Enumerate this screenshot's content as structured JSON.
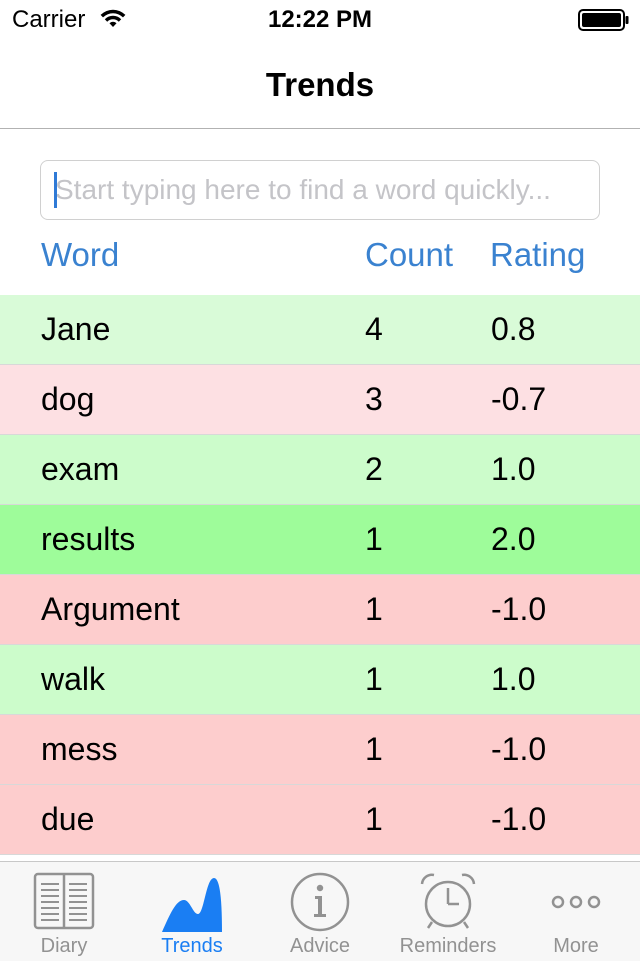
{
  "status_bar": {
    "carrier": "Carrier",
    "time": "12:22 PM"
  },
  "nav": {
    "title": "Trends"
  },
  "search": {
    "placeholder": "Start typing here to find a word quickly...",
    "value": ""
  },
  "table": {
    "headers": {
      "word": "Word",
      "count": "Count",
      "rating": "Rating"
    },
    "rows": [
      {
        "word": "Jane",
        "count": "4",
        "rating": "0.8",
        "color": "#d9fbd8"
      },
      {
        "word": "dog",
        "count": "3",
        "rating": "-0.7",
        "color": "#fde0e3"
      },
      {
        "word": "exam",
        "count": "2",
        "rating": "1.0",
        "color": "#ccfccb"
      },
      {
        "word": "results",
        "count": "1",
        "rating": "2.0",
        "color": "#9efc9a"
      },
      {
        "word": "Argument",
        "count": "1",
        "rating": "-1.0",
        "color": "#fdcdcd"
      },
      {
        "word": "walk",
        "count": "1",
        "rating": "1.0",
        "color": "#ccfccb"
      },
      {
        "word": "mess",
        "count": "1",
        "rating": "-1.0",
        "color": "#fdcdcd"
      },
      {
        "word": "due",
        "count": "1",
        "rating": "-1.0",
        "color": "#fdcdcd"
      }
    ]
  },
  "tab_bar": {
    "tabs": [
      {
        "label": "Diary",
        "icon": "book-icon",
        "active": false
      },
      {
        "label": "Trends",
        "icon": "trends-icon",
        "active": true
      },
      {
        "label": "Advice",
        "icon": "info-icon",
        "active": false
      },
      {
        "label": "Reminders",
        "icon": "alarm-clock-icon",
        "active": false
      },
      {
        "label": "More",
        "icon": "more-icon",
        "active": false
      }
    ]
  },
  "colors": {
    "accent": "#1a7ef3",
    "header_text": "#3a82d0",
    "inactive_tab": "#929292"
  }
}
